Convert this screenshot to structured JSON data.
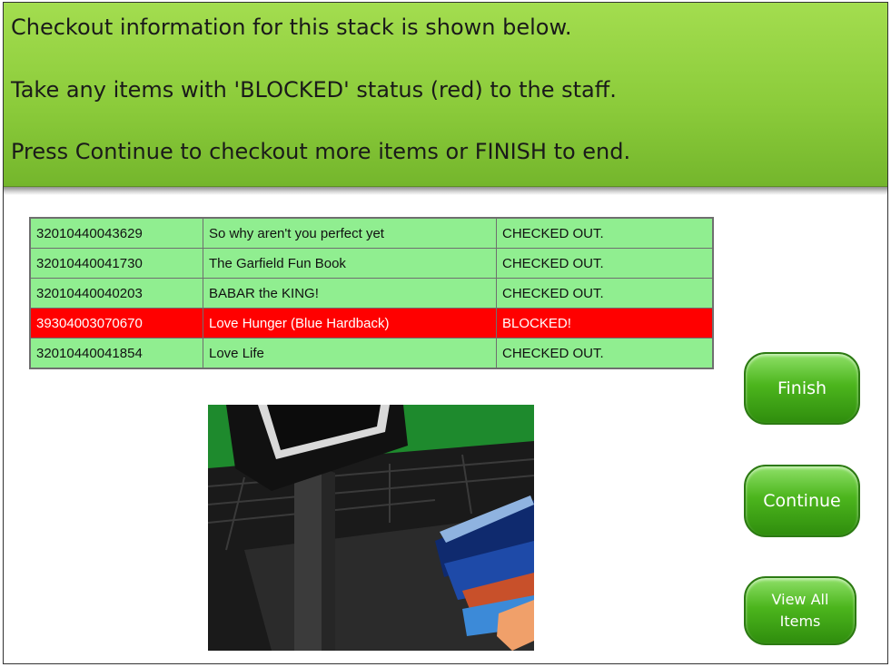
{
  "instructions": {
    "line1": "Checkout information for this stack is shown below.",
    "line2": "Take any items with 'BLOCKED' status (red) to the staff.",
    "line3": "Press Continue to checkout more items or FINISH to end."
  },
  "items": [
    {
      "barcode": "32010440043629",
      "title": "So why aren't you perfect yet",
      "status": "CHECKED OUT."
    },
    {
      "barcode": "32010440041730",
      "title": "The Garfield Fun Book",
      "status": "CHECKED OUT."
    },
    {
      "barcode": "32010440040203",
      "title": "BABAR the KING!",
      "status": "CHECKED OUT."
    },
    {
      "barcode": "39304003070670",
      "title": "Love Hunger (Blue Hardback)",
      "status": "BLOCKED!"
    },
    {
      "barcode": "32010440041854",
      "title": "Love Life",
      "status": "CHECKED OUT."
    }
  ],
  "buttons": {
    "finish": "Finish",
    "continue": "Continue",
    "view_all": "View All Items"
  },
  "colors": {
    "banner": "#8ccc3b",
    "row_ok": "#90ee90",
    "row_blocked": "#ff0000",
    "button": "#4cb51d"
  },
  "scene_icon": "kiosk-scanning-books-image"
}
